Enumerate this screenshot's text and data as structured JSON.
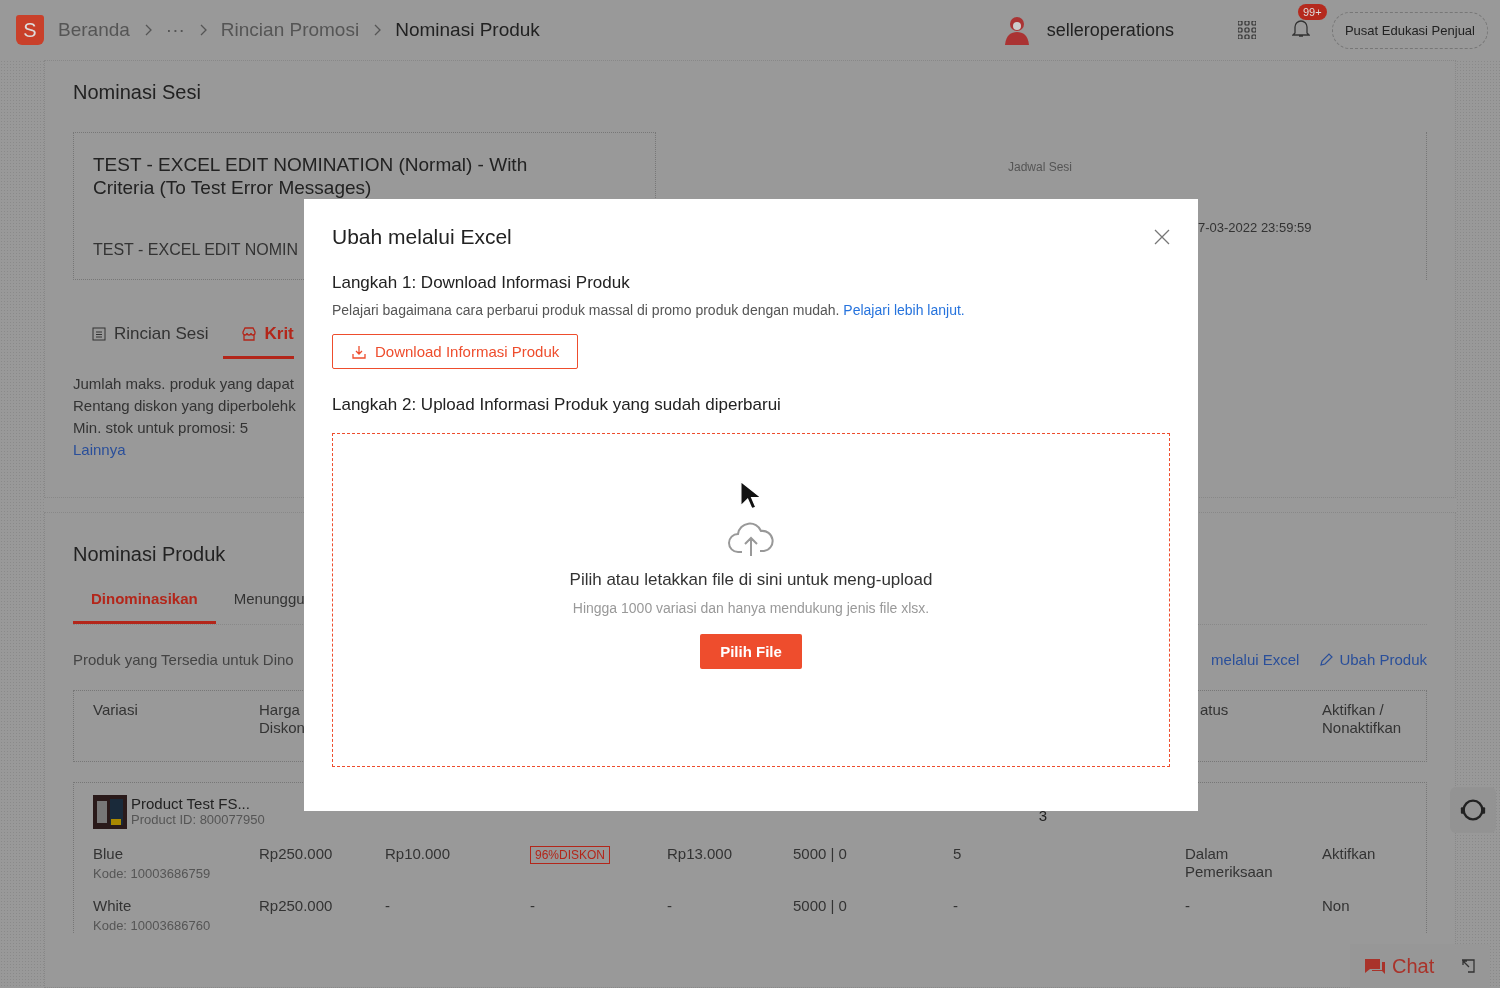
{
  "header": {
    "logo_letter": "S",
    "breadcrumb": [
      {
        "label": "Beranda",
        "current": false
      },
      {
        "label": "···",
        "current": false
      },
      {
        "label": "Rincian Promosi",
        "current": false
      },
      {
        "label": "Nominasi Produk",
        "current": true
      }
    ],
    "user": "selleroperations",
    "notification_badge": "99+",
    "help_button": "Pusat Edukasi Penjual"
  },
  "session": {
    "heading": "Nominasi Sesi",
    "title": "TEST - EXCEL EDIT NOMINATION (Normal) - With Criteria (To Test Error Messages)",
    "subtitle": "TEST - EXCEL EDIT NOMIN",
    "schedule_label": "Jadwal Sesi",
    "schedule_end": "7-03-2022 23:59:59",
    "tabs": [
      {
        "label": "Rincian Sesi",
        "selected": false
      },
      {
        "label": "Krit",
        "selected": true
      }
    ],
    "criteria": [
      "Jumlah maks. produk yang dapat",
      "Rentang diskon yang diperbolehk",
      "Min. stok untuk promosi: 5"
    ],
    "more_link": "Lainnya"
  },
  "products": {
    "heading": "Nominasi Produk",
    "tabs": [
      {
        "label": "Dinominasikan",
        "selected": true
      },
      {
        "label": "Menunggu",
        "selected": false
      }
    ],
    "available_text": "Produk yang Tersedia untuk Dino",
    "excel_link": "melalui Excel",
    "edit_link": "Ubah Produk",
    "columns_left": [
      "Variasi",
      "Harga\nDiskon"
    ],
    "columns_right": [
      "atus",
      "Aktifkan /\nNonaktifkan"
    ],
    "product": {
      "name": "Product Test FS...",
      "id": "Product ID: 800077950",
      "count": "3"
    },
    "rows": [
      {
        "name": "Blue",
        "code": "Kode: 10003686759",
        "cells": [
          {
            "kind": "text",
            "text": "Rp250.000"
          },
          {
            "kind": "text",
            "text": "Rp10.000"
          },
          {
            "kind": "badge",
            "text": "96%DISKON"
          },
          {
            "kind": "text",
            "text": "Rp13.000"
          },
          {
            "kind": "text",
            "text": "5000 | 0"
          },
          {
            "kind": "text",
            "text": "5"
          },
          {
            "kind": "text",
            "text": "Dalam\nPemeriksaan"
          },
          {
            "kind": "text",
            "text": "Aktifkan"
          }
        ]
      },
      {
        "name": "White",
        "code": "Kode: 10003686760",
        "cells": [
          {
            "kind": "text",
            "text": "Rp250.000"
          },
          {
            "kind": "text",
            "text": "-"
          },
          {
            "kind": "text",
            "text": "-"
          },
          {
            "kind": "text",
            "text": "-"
          },
          {
            "kind": "text",
            "text": "5000 | 0"
          },
          {
            "kind": "text",
            "text": "-"
          },
          {
            "kind": "text",
            "text": "-"
          },
          {
            "kind": "text",
            "text": "Non"
          }
        ]
      }
    ]
  },
  "modal": {
    "title": "Ubah melalui Excel",
    "step1": "Langkah 1: Download Informasi Produk",
    "step1_text": "Pelajari bagaimana cara perbarui produk massal di promo produk dengan mudah.",
    "step1_link": "Pelajari lebih lanjut.",
    "download_button": "Download Informasi Produk",
    "step2": "Langkah 2: Upload Informasi Produk yang sudah diperbarui",
    "drop_title": "Pilih atau letakkan file di sini untuk meng-upload",
    "drop_hint": "Hingga 1000 variasi dan hanya mendukung jenis file xlsx.",
    "choose_button": "Pilih File"
  },
  "chat": {
    "label": "Chat"
  }
}
